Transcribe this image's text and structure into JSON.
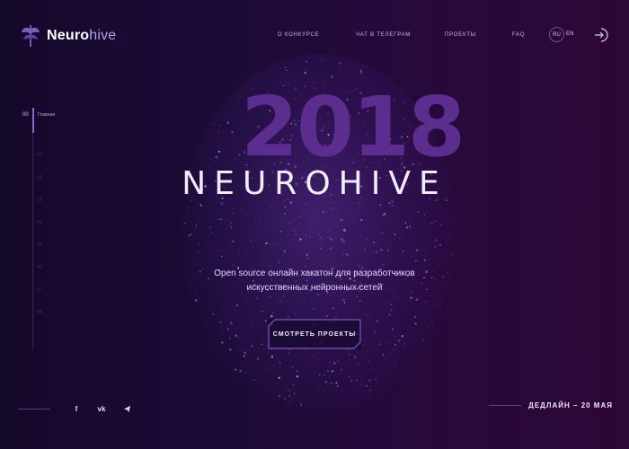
{
  "brand": {
    "name_bold": "Neuro",
    "name_light": "hive"
  },
  "nav": {
    "items": [
      {
        "label": "О КОНКУРСЕ"
      },
      {
        "label": "ЧАТ В ТЕЛЕГРАМ"
      },
      {
        "label": "ПРОЕКТЫ"
      },
      {
        "label": "FAQ"
      }
    ]
  },
  "lang": {
    "active": "RU",
    "other": "EN"
  },
  "hero": {
    "year": "2018",
    "title": "NEUROHIVE",
    "subtitle_line1": "Open source онлайн хакатон для разработчиков",
    "subtitle_line2": "искусственных нейронных сетей",
    "cta": "СМОТРЕТЬ ПРОЕКТЫ"
  },
  "rail": {
    "current_num": "00",
    "current_label": "Главная",
    "ticks": [
      "01",
      "02",
      "03",
      "04",
      "05",
      "06",
      "07",
      "08"
    ]
  },
  "socials": [
    {
      "icon": "facebook-icon",
      "glyph": "f"
    },
    {
      "icon": "vk-icon",
      "glyph": "vk"
    },
    {
      "icon": "telegram-icon",
      "glyph": "◂"
    }
  ],
  "footer": {
    "deadline": "ДЕДЛАЙН – 20 МАЯ"
  },
  "colors": {
    "accent": "#8a63d2",
    "year": "#5b2d8e",
    "background": "#1c0b36"
  }
}
